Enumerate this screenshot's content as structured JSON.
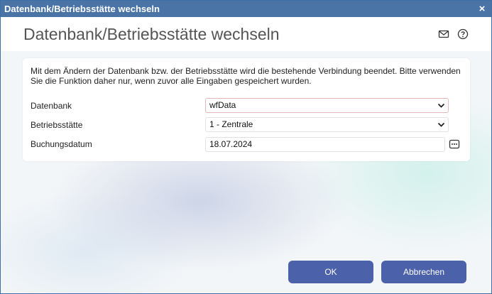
{
  "window": {
    "title": "Datenbank/Betriebsstätte wechseln",
    "close_glyph": "×"
  },
  "header": {
    "title": "Datenbank/Betriebsstätte wechseln",
    "icons": [
      "mail-icon",
      "help-icon"
    ]
  },
  "info_text": "Mit dem Ändern der Datenbank bzw. der Betriebsstätte wird die bestehende Verbindung beendet. Bitte verwenden Sie die Funktion daher nur, wenn zuvor alle Eingaben gespeichert wurden.",
  "form": {
    "datenbank": {
      "label": "Datenbank",
      "value": "wfData"
    },
    "betriebsstaette": {
      "label": "Betriebsstätte",
      "value": "1 - Zentrale"
    },
    "buchungsdatum": {
      "label": "Buchungsdatum",
      "value": "18.07.2024"
    }
  },
  "buttons": {
    "ok": "OK",
    "cancel": "Abbrechen"
  },
  "colors": {
    "titlebar": "#4a73a6",
    "button": "#4b61aa",
    "focus_border": "#e7b8b8"
  }
}
